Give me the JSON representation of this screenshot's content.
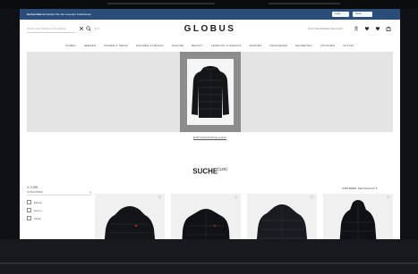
{
  "notice": {
    "bold": "Herbst-Sale",
    "text": "Entdecken Sie die neuesten Kollektionen",
    "buttons": [
      "Login",
      "Konto"
    ]
  },
  "header": {
    "search_placeholder": "Suche nach Marken & Produkten",
    "brand": "GLOBUS",
    "account_text": "Konto  Tag  Merkliste  Warenkorb",
    "icons": [
      "close-icon",
      "search-icon",
      "language-icon",
      "user-icon",
      "heart-icon",
      "bag-icon"
    ]
  },
  "nav": {
    "items": [
      "DAMEN",
      "HERREN",
      "KINDER & TEENS",
      "WOHNEN & DESIGN",
      "SCHUHE",
      "BEAUTY",
      "FEINKOST & GENUSS",
      "MARKEN",
      "GESCHENKE",
      "NEUHEITEN",
      "AKTIONEN",
      "OUTLET"
    ]
  },
  "banner": {
    "caption": "Mit Suchbild Erfolg suchen"
  },
  "search": {
    "title": "SUCHE",
    "count": "(120)"
  },
  "filters": {
    "result_count": "✕  3.250",
    "section_title": "KATEGORIEN",
    "options": [
      "Damen",
      "Herren",
      "Kinder"
    ]
  },
  "sort": {
    "label": "SORTIEREN: Nach Relevanz  ▾"
  },
  "colors": {
    "notice_bg": "#2a4d7a",
    "banner_bg": "#e4e4e4",
    "hero_frame": "#8c8c8c",
    "jacket": "#15161a"
  }
}
